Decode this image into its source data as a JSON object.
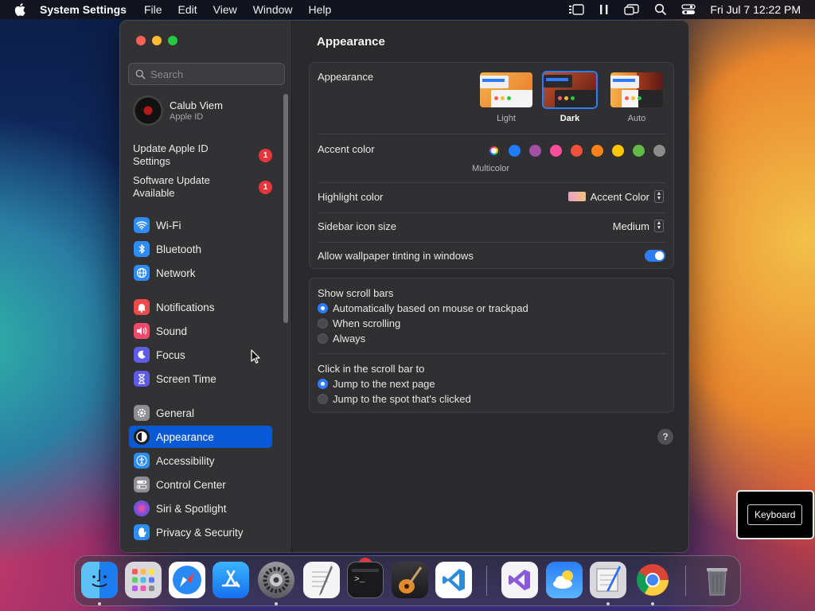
{
  "menubar": {
    "app_name": "System Settings",
    "menus": [
      "File",
      "Edit",
      "View",
      "Window",
      "Help"
    ],
    "clock": "Fri Jul 7  12:22 PM"
  },
  "window": {
    "search": {
      "placeholder": "Search"
    },
    "account": {
      "name": "Calub Viem",
      "sub": "Apple ID"
    },
    "notices": [
      {
        "label": "Update Apple ID Settings",
        "badge": "1"
      },
      {
        "label": "Software Update Available",
        "badge": "1"
      }
    ],
    "sidebar": {
      "items": [
        {
          "label": "Wi-Fi",
          "icon": "wifi-icon",
          "color": "#2f8cf5"
        },
        {
          "label": "Bluetooth",
          "icon": "bluetooth-icon",
          "color": "#2f8cf5"
        },
        {
          "label": "Network",
          "icon": "globe-icon",
          "color": "#2f8cf5"
        },
        {
          "label": "Notifications",
          "icon": "bell-icon",
          "color": "#ef4a4a"
        },
        {
          "label": "Sound",
          "icon": "speaker-icon",
          "color": "#ef4a6a"
        },
        {
          "label": "Focus",
          "icon": "moon-icon",
          "color": "#5e5ce6"
        },
        {
          "label": "Screen Time",
          "icon": "hourglass-icon",
          "color": "#5e5ce6"
        },
        {
          "label": "General",
          "icon": "gear-icon",
          "color": "#8e8e93"
        },
        {
          "label": "Appearance",
          "icon": "appearance-icon",
          "color": "#1c1c1e",
          "active": true
        },
        {
          "label": "Accessibility",
          "icon": "accessibility-icon",
          "color": "#2f8cf5"
        },
        {
          "label": "Control Center",
          "icon": "switches-icon",
          "color": "#8e8e93"
        },
        {
          "label": "Siri & Spotlight",
          "icon": "siri-icon",
          "color": "#7a4bd8"
        },
        {
          "label": "Privacy & Security",
          "icon": "hand-icon",
          "color": "#2f8cf5"
        }
      ]
    }
  },
  "content": {
    "title": "Appearance",
    "appearance": {
      "label": "Appearance",
      "options": [
        {
          "label": "Light",
          "selected": false
        },
        {
          "label": "Dark",
          "selected": true
        },
        {
          "label": "Auto",
          "selected": false
        }
      ]
    },
    "accent": {
      "label": "Accent color",
      "selected_label": "Multicolor",
      "colors": [
        "multicolor",
        "#1f7cf5",
        "#a550a7",
        "#f74f9e",
        "#f0503c",
        "#f7821b",
        "#ffc600",
        "#62ba46",
        "#8c8c8c"
      ]
    },
    "highlight": {
      "label": "Highlight color",
      "value": "Accent Color"
    },
    "icon_size": {
      "label": "Sidebar icon size",
      "value": "Medium"
    },
    "tinting": {
      "label": "Allow wallpaper tinting in windows",
      "enabled": true
    },
    "scroll_bars": {
      "label": "Show scroll bars",
      "options": [
        {
          "label": "Automatically based on mouse or trackpad",
          "selected": true
        },
        {
          "label": "When scrolling",
          "selected": false
        },
        {
          "label": "Always",
          "selected": false
        }
      ]
    },
    "scroll_click": {
      "label": "Click in the scroll bar to",
      "options": [
        {
          "label": "Jump to the next page",
          "selected": true
        },
        {
          "label": "Jump to the spot that's clicked",
          "selected": false
        }
      ]
    },
    "help": "?"
  },
  "hud": {
    "key": "Keyboard"
  },
  "dock": {
    "apps": [
      "Finder",
      "Launchpad",
      "Safari",
      "App Store",
      "System Settings",
      "TextEdit",
      "Terminal",
      "GarageBand",
      "Visual Studio Code",
      "Visual Studio",
      "Weather",
      "Script Editor",
      "Chrome",
      "Trash"
    ],
    "settings_badge": "2"
  }
}
